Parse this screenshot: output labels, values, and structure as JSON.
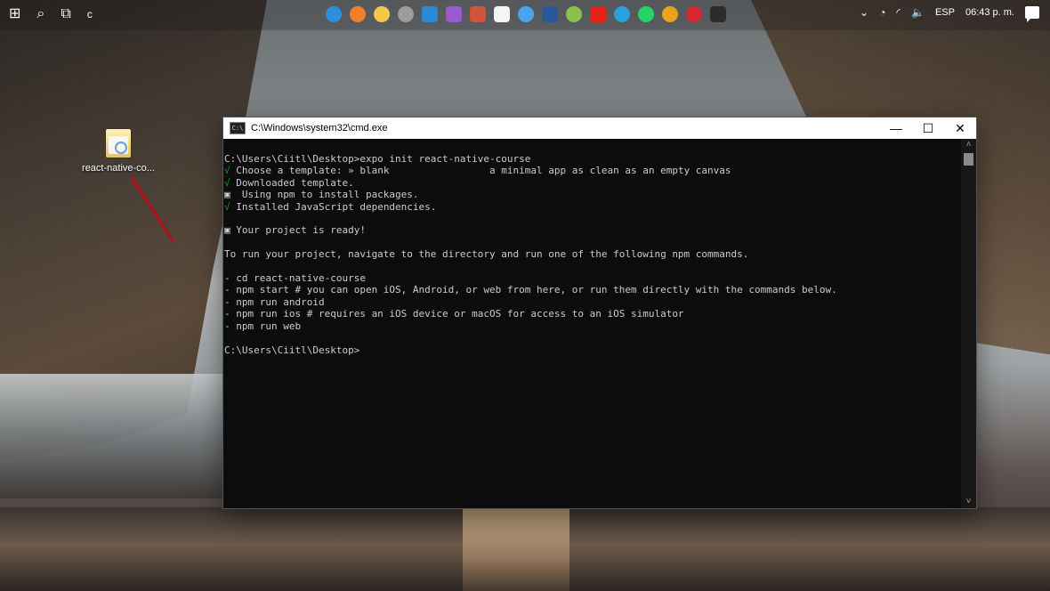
{
  "taskbar": {
    "search_icon": "search-icon",
    "task_view_label": "c",
    "apps": [
      {
        "name": "edge",
        "color": "#2f8fde",
        "shape": "round"
      },
      {
        "name": "firefox",
        "color": "#f0802a",
        "shape": "round"
      },
      {
        "name": "chrome-alt",
        "color": "#f2c94c",
        "shape": "round"
      },
      {
        "name": "app4",
        "color": "#9c9c9c",
        "shape": "round"
      },
      {
        "name": "vscode",
        "color": "#2a8ad6",
        "shape": "square"
      },
      {
        "name": "visual-studio",
        "color": "#9b59d0",
        "shape": "square"
      },
      {
        "name": "app7",
        "color": "#d4533b",
        "shape": "square"
      },
      {
        "name": "intellij",
        "color": "#f5f5f5",
        "shape": "square"
      },
      {
        "name": "app9",
        "color": "#4aa3f0",
        "shape": "round"
      },
      {
        "name": "word",
        "color": "#2b579a",
        "shape": "square"
      },
      {
        "name": "app11",
        "color": "#8bc34a",
        "shape": "round"
      },
      {
        "name": "youtube",
        "color": "#e62117",
        "shape": "square"
      },
      {
        "name": "telegram",
        "color": "#2aa1da",
        "shape": "round"
      },
      {
        "name": "whatsapp",
        "color": "#25d366",
        "shape": "round"
      },
      {
        "name": "chrome",
        "color": "#e9a21b",
        "shape": "round"
      },
      {
        "name": "pinterest",
        "color": "#d7272f",
        "shape": "round"
      },
      {
        "name": "cmd",
        "color": "#2c2c2c",
        "shape": "square"
      }
    ],
    "language": "ESP",
    "time": "06:43 p. m."
  },
  "desktop": {
    "icon_label": "react-native-co..."
  },
  "cmd": {
    "title": "C:\\Windows\\system32\\cmd.exe",
    "icon_text": "C:\\",
    "minimize": "—",
    "maximize": "☐",
    "close": "✕",
    "lines": [
      {
        "text": "C:\\Users\\Ciitl\\Desktop>expo init react-native-course"
      },
      {
        "mark": "√ ",
        "text": "Choose a template: » blank                 a minimal app as clean as an empty canvas"
      },
      {
        "mark": "√ ",
        "text": "Downloaded template."
      },
      {
        "text": "▣  Using npm to install packages."
      },
      {
        "mark": "√ ",
        "text": "Installed JavaScript dependencies."
      },
      {
        "text": ""
      },
      {
        "text": "▣ Your project is ready!"
      },
      {
        "text": ""
      },
      {
        "text": "To run your project, navigate to the directory and run one of the following npm commands."
      },
      {
        "text": ""
      },
      {
        "text": "- cd react-native-course"
      },
      {
        "text": "- npm start # you can open iOS, Android, or web from here, or run them directly with the commands below."
      },
      {
        "text": "- npm run android"
      },
      {
        "text": "- npm run ios # requires an iOS device or macOS for access to an iOS simulator"
      },
      {
        "text": "- npm run web"
      },
      {
        "text": ""
      },
      {
        "text": "C:\\Users\\Ciitl\\Desktop>"
      }
    ]
  }
}
